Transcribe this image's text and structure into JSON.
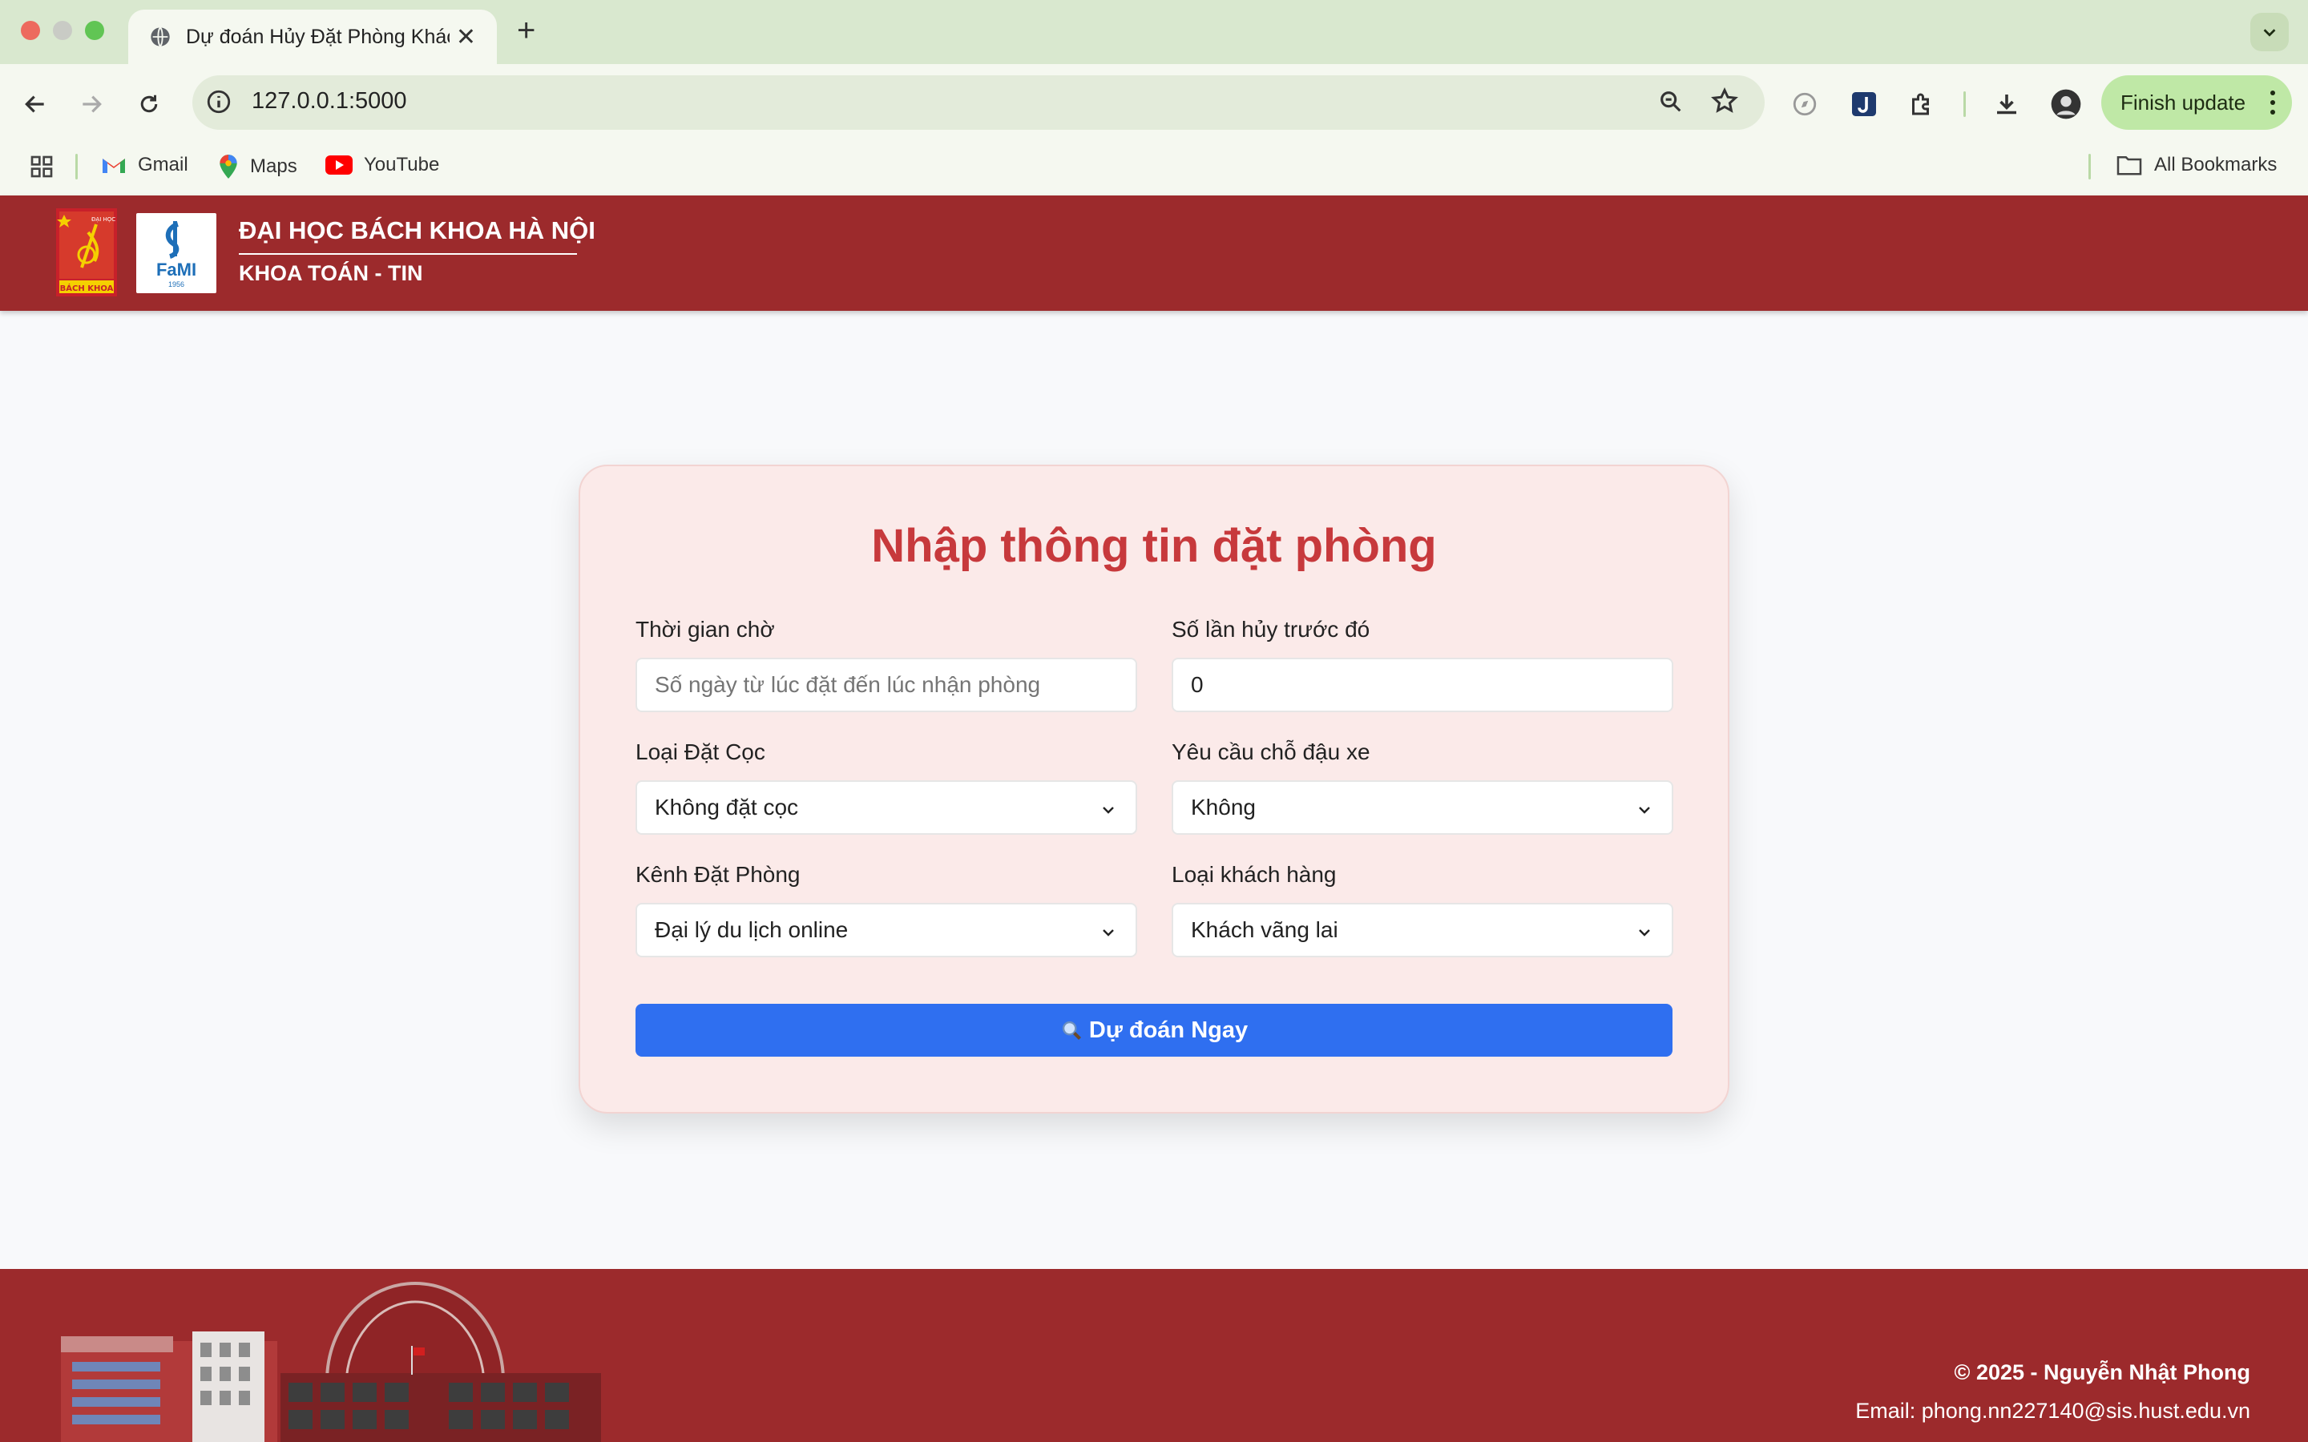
{
  "browser": {
    "tab_title": "Dự đoán Hủy Đặt Phòng Khác",
    "url": "127.0.0.1:5000",
    "finish_update": "Finish update",
    "bookmarks": [
      {
        "label": "Gmail",
        "icon": "gmail-icon"
      },
      {
        "label": "Maps",
        "icon": "maps-icon"
      },
      {
        "label": "YouTube",
        "icon": "youtube-icon"
      }
    ],
    "all_bookmarks": "All Bookmarks"
  },
  "header": {
    "university": "ĐẠI HỌC BÁCH KHOA HÀ NỘI",
    "department": "KHOA TOÁN - TIN",
    "logo1_text_top": "ĐẠI HỌC",
    "logo1_text_bottom": "BÁCH KHOA",
    "logo2_text": "FaMI",
    "logo2_year": "1956"
  },
  "form": {
    "title": "Nhập thông tin đặt phòng",
    "lead_time": {
      "label": "Thời gian chờ",
      "placeholder": "Số ngày từ lúc đặt đến lúc nhận phòng",
      "value": ""
    },
    "prev_cancel": {
      "label": "Số lần hủy trước đó",
      "value": "0"
    },
    "deposit": {
      "label": "Loại Đặt Cọc",
      "value": "Không đặt cọc"
    },
    "parking": {
      "label": "Yêu cầu chỗ đậu xe",
      "value": "Không"
    },
    "channel": {
      "label": "Kênh Đặt Phòng",
      "value": "Đại lý du lịch online"
    },
    "customer": {
      "label": "Loại khách hàng",
      "value": "Khách vãng lai"
    },
    "submit": "Dự đoán Ngay"
  },
  "footer": {
    "copyright": "© 2025 - Nguyễn Nhật Phong",
    "email": "Email: phong.nn227140@sis.hust.edu.vn"
  },
  "colors": {
    "brand": "#9c2a2c",
    "title": "#c7393c",
    "button": "#2f6ff0",
    "card": "#fbeae9"
  }
}
